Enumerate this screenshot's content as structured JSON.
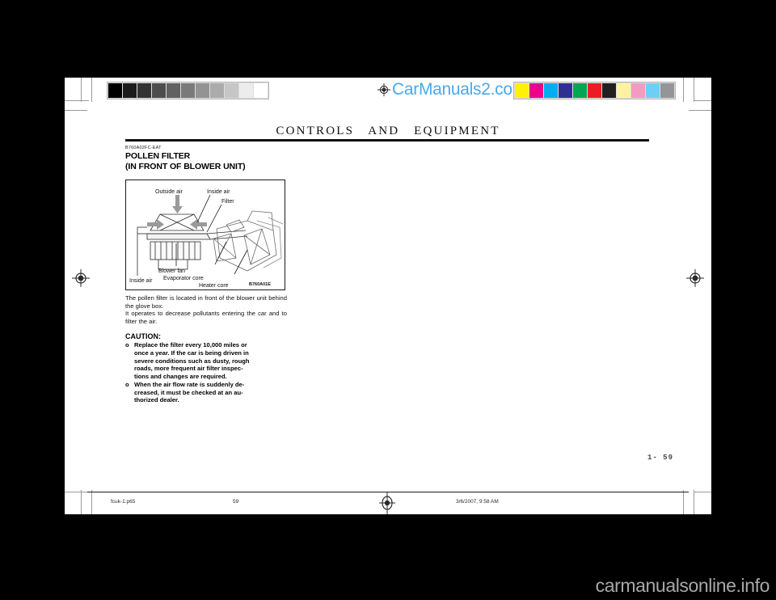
{
  "document": {
    "running_head": "CONTROLS   AND   EQUIPMENT",
    "section_code": "B760A02FC-EAT",
    "section_title_line1": "POLLEN FILTER",
    "section_title_line2": "(IN FRONT OF BLOWER UNIT)",
    "folio": "1- 59"
  },
  "figure": {
    "code": "B760A01E",
    "labels": {
      "outside_air": "Outside air",
      "inside_air_top": "Inside air",
      "filter": "Filter",
      "blower_fan": "Blower fan",
      "evaporator_core": "Evaporator core",
      "heater_core": "Heater core",
      "inside_air_bottom": "Inside air"
    }
  },
  "body": {
    "paragraph1": "The pollen filter is located in front of the blower unit behind the glove box.",
    "paragraph2": "It operates to decrease pollutants entering the car and to filter the air.",
    "caution_heading": "CAUTION:",
    "bullets": [
      {
        "marker": "o",
        "lines": [
          "Replace the filter every 10,000 miles or",
          "once a year. If the car is being driven in",
          "severe conditions such as dusty, rough",
          "roads, more frequent air filter inspec-",
          "tions and changes are required."
        ]
      },
      {
        "marker": "o",
        "lines": [
          "When the air flow rate is suddenly de-",
          "creased, it must be checked at an au-",
          "thorized  dealer."
        ]
      }
    ]
  },
  "print_slug": {
    "filename": "fcuk-1.p65",
    "page": "59",
    "timestamp": "3/6/2007, 9:58 AM"
  },
  "brand": {
    "watermark_top": "CarManuals2.com",
    "watermark_bottom": "carmanualsonline.info",
    "watermark_top_color": "#4aa8ee",
    "watermark_bottom_color": "#a8a8a8"
  },
  "calibration": {
    "grayscale_swatches": [
      "#000000",
      "#1c1c1c",
      "#333333",
      "#4d4d4d",
      "#616161",
      "#7a7a7a",
      "#939393",
      "#ababab",
      "#c6c6c6",
      "#ececec",
      "#ffffff"
    ],
    "color_swatches": [
      "#fff200",
      "#ec008c",
      "#00aeef",
      "#2e3192",
      "#00a651",
      "#ed1c24",
      "#231f20",
      "#fbf3a0",
      "#f49ac1",
      "#6dcff6",
      "#939598"
    ]
  }
}
